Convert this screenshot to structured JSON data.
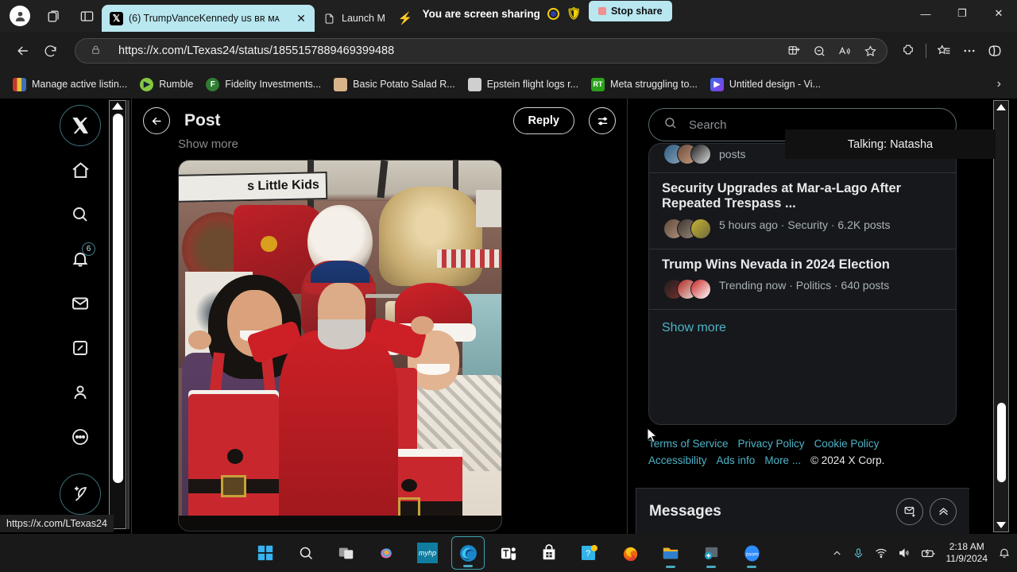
{
  "browser": {
    "tabs": [
      {
        "title": "(6) TrumpVanceKennedy us ʙʀ ᴍᴀ",
        "favicon": "x-logo",
        "active": true
      },
      {
        "title": "Launch M",
        "favicon": "document-icon",
        "active": false
      }
    ],
    "screen_share": {
      "message": "You are screen sharing",
      "stop_label": "Stop share"
    },
    "url": "https://x.com/LTexas24/status/1855157889469399488",
    "status_url": "https://x.com/LTexas24",
    "bookmarks": [
      {
        "label": "Manage active listin...",
        "icon": "briefcase-icon",
        "color": "#c9362c"
      },
      {
        "label": "Rumble",
        "icon": "rumble-icon",
        "color": "#85c742"
      },
      {
        "label": "Fidelity Investments...",
        "icon": "fidelity-icon",
        "color": "#2e7d32"
      },
      {
        "label": "Basic Potato Salad R...",
        "icon": "recipe-icon",
        "color": "#d9b48a"
      },
      {
        "label": "Epstein flight logs r...",
        "icon": "news-icon",
        "color": "#b8b8b8"
      },
      {
        "label": "Meta struggling to...",
        "icon": "rt-icon",
        "color": "#2aa21a"
      },
      {
        "label": "Untitled design - Vi...",
        "icon": "canva-video-icon",
        "color": "#3a6ef0"
      }
    ],
    "window_controls": {
      "minimize": "—",
      "maximize": "❐",
      "close": "✕"
    }
  },
  "x_app": {
    "nav_items": [
      {
        "name": "x-logo",
        "label": "X"
      },
      {
        "name": "home",
        "label": "Home"
      },
      {
        "name": "search",
        "label": "Search"
      },
      {
        "name": "notifications",
        "label": "Notifications",
        "badge": "6"
      },
      {
        "name": "messages",
        "label": "Messages"
      },
      {
        "name": "grok",
        "label": "Grok"
      },
      {
        "name": "profile",
        "label": "Profile"
      },
      {
        "name": "more",
        "label": "More"
      },
      {
        "name": "compose",
        "label": "Post"
      }
    ],
    "post": {
      "header_title": "Post",
      "reply_button": "Reply",
      "show_more": "Show more",
      "image_alt_text": "s Little Kids"
    },
    "search": {
      "placeholder": "Search"
    },
    "trends": {
      "cropped_item": {
        "meta": "posts"
      },
      "items": [
        {
          "title": "Security Upgrades at Mar-a-Lago After Repeated Trespass ...",
          "meta": "5 hours ago · Security · 6.2K posts"
        },
        {
          "title": "Trump Wins Nevada in 2024 Election",
          "meta": "Trending now · Politics · 640 posts"
        }
      ],
      "show_more": "Show more"
    },
    "footer": {
      "links": [
        "Terms of Service",
        "Privacy Policy",
        "Cookie Policy",
        "Accessibility",
        "Ads info",
        "More ..."
      ],
      "copyright": "© 2024 X Corp."
    },
    "messages": {
      "title": "Messages"
    }
  },
  "overlay": {
    "talking_tooltip": "Talking: Natasha"
  },
  "taskbar": {
    "apps": [
      {
        "name": "start-windows-icon",
        "label": "Start"
      },
      {
        "name": "search-icon",
        "label": "Search"
      },
      {
        "name": "task-view-icon",
        "label": "Task View"
      },
      {
        "name": "copilot-icon",
        "label": "Copilot"
      },
      {
        "name": "myhp-icon",
        "label": "myHP"
      },
      {
        "name": "edge-icon",
        "label": "Microsoft Edge",
        "active": true
      },
      {
        "name": "teams-icon",
        "label": "Microsoft Teams"
      },
      {
        "name": "store-icon",
        "label": "Microsoft Store"
      },
      {
        "name": "help-icon",
        "label": "Get Help"
      },
      {
        "name": "firefox-icon",
        "label": "Firefox"
      },
      {
        "name": "file-explorer-icon",
        "label": "File Explorer"
      },
      {
        "name": "snipping-tool-icon",
        "label": "Snipping Tool"
      },
      {
        "name": "zoom-icon",
        "label": "Zoom"
      }
    ],
    "tray": {
      "chevron": "^",
      "mic": "microphone-icon",
      "wifi": "wifi-icon",
      "volume": "speaker-icon",
      "battery": "battery-icon",
      "time": "2:18 AM",
      "date": "11/9/2024",
      "notifications": "bell-icon"
    }
  },
  "colors": {
    "accent_cyan": "#b8e7f0",
    "link_blue": "#4db3c7",
    "page_bg": "#000000",
    "card_bg": "#16181c",
    "border": "#2f3336"
  }
}
